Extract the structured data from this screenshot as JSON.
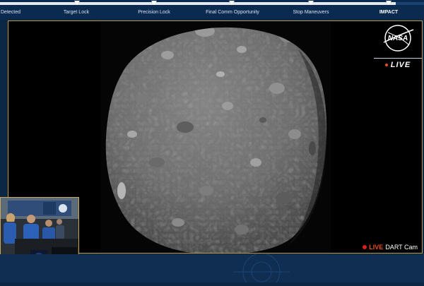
{
  "timeline": {
    "milestones": [
      {
        "label": "Detected",
        "active": false
      },
      {
        "label": "Target Lock",
        "active": false
      },
      {
        "label": "Precision Lock",
        "active": false
      },
      {
        "label": "Final Comm Opportunity",
        "active": false
      },
      {
        "label": "Stop Maneuvers",
        "active": false
      },
      {
        "label": "IMPACT",
        "active": true
      }
    ]
  },
  "logo": {
    "text": "NASA"
  },
  "live_badge": {
    "text": "LIVE"
  },
  "camera": {
    "live_label": "LIVE",
    "name": "DART Cam"
  },
  "colors": {
    "background": "#0c2746",
    "timeline_track": "#e4e9ee",
    "frame_border": "#b89a47",
    "live_orange": "#e8501d",
    "rec_red": "#e01e1e"
  }
}
